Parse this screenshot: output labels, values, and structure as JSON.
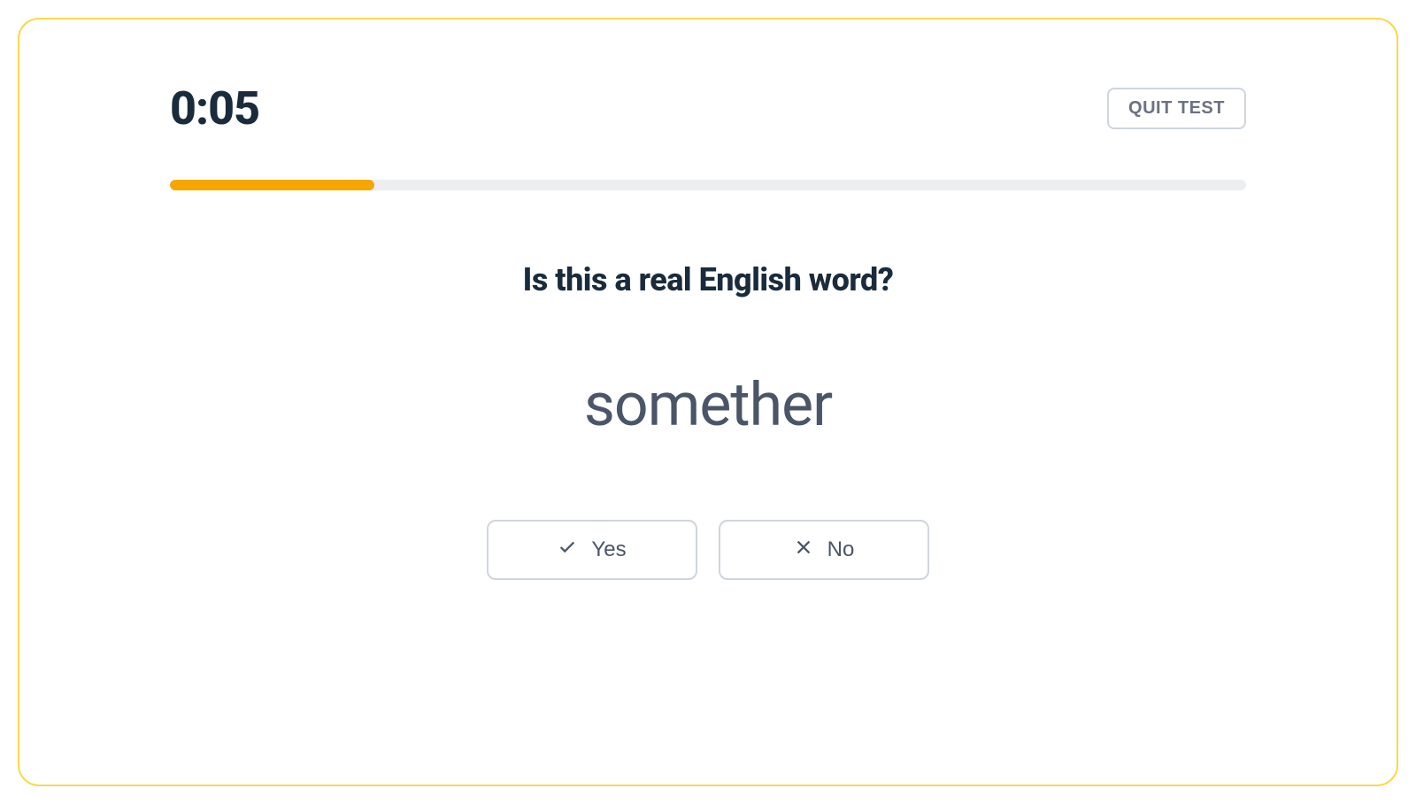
{
  "header": {
    "timer": "0:05",
    "quit_label": "QUIT TEST"
  },
  "progress": {
    "percent": 19
  },
  "question": "Is this a real English word?",
  "word": "somether",
  "answers": {
    "yes_label": "Yes",
    "no_label": "No"
  },
  "colors": {
    "accent_yellow": "#f7d94c",
    "progress_orange": "#f7a600",
    "text_dark": "#1a2b3c",
    "text_gray": "#4a5568",
    "border_gray": "#d0d5dd"
  }
}
